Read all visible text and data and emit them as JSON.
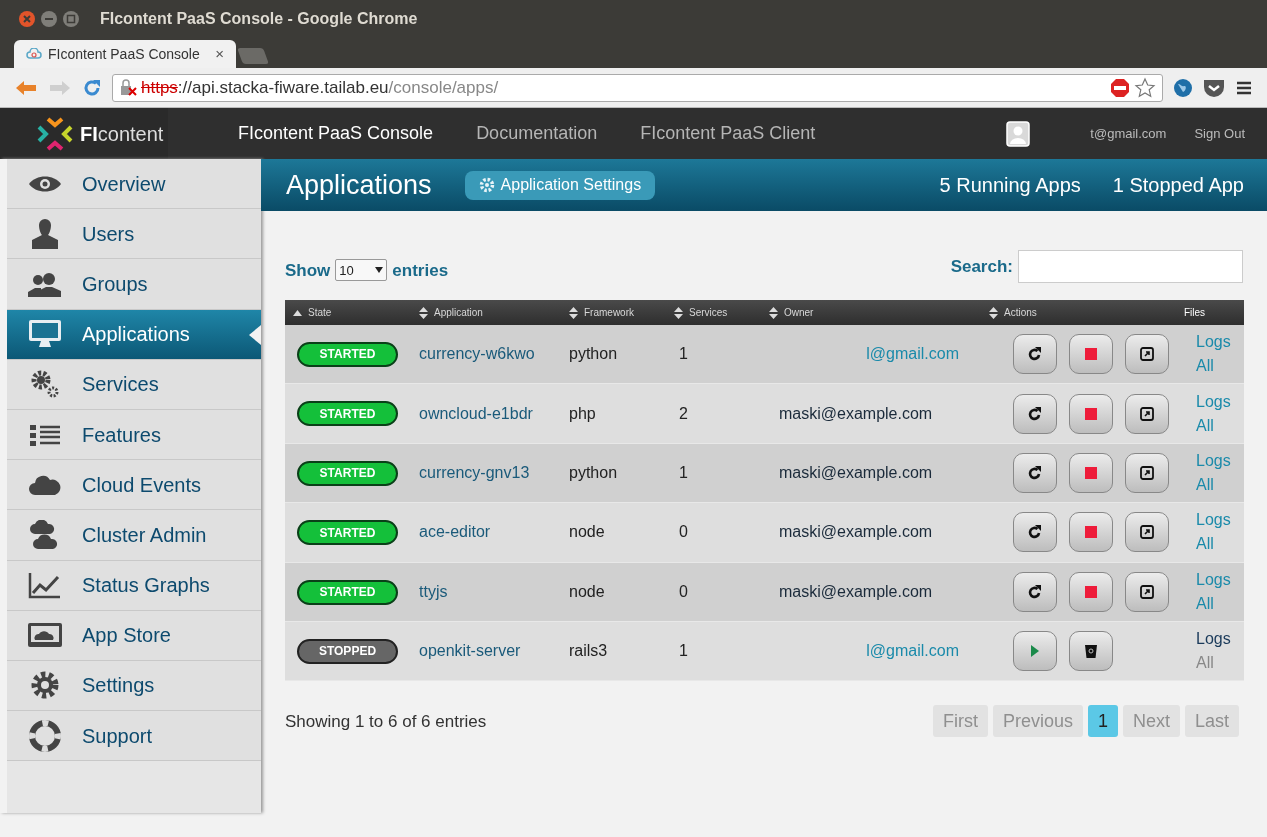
{
  "window": {
    "title": "FIcontent PaaS Console - Google Chrome"
  },
  "browser_tab": {
    "label": "FIcontent PaaS Console",
    "close": "×"
  },
  "address_bar": {
    "scheme": "https",
    "host": "://api.stacka-fiware.tailab.eu",
    "path": "/console/apps/"
  },
  "navbar": {
    "logo_bold": "FI",
    "logo_light": "content",
    "links": [
      {
        "label": "FIcontent PaaS Console",
        "selected": true
      },
      {
        "label": "Documentation",
        "selected": false
      },
      {
        "label": "FIcontent PaaS Client",
        "selected": false
      }
    ],
    "user_email": "t@gmail.com",
    "sign_out": "Sign Out"
  },
  "sidebar": {
    "items": [
      {
        "label": "Overview",
        "selected": false
      },
      {
        "label": "Users",
        "selected": false
      },
      {
        "label": "Groups",
        "selected": false
      },
      {
        "label": "Applications",
        "selected": true
      },
      {
        "label": "Services",
        "selected": false
      },
      {
        "label": "Features",
        "selected": false
      },
      {
        "label": "Cloud Events",
        "selected": false
      },
      {
        "label": "Cluster Admin",
        "selected": false
      },
      {
        "label": "Status Graphs",
        "selected": false
      },
      {
        "label": "App Store",
        "selected": false
      },
      {
        "label": "Settings",
        "selected": false
      },
      {
        "label": "Support",
        "selected": false
      }
    ]
  },
  "header": {
    "title": "Applications",
    "settings_button": "Application Settings",
    "running": "5 Running Apps",
    "stopped": "1 Stopped App"
  },
  "table_controls": {
    "show": "Show",
    "page_size": "10",
    "entries": "entries",
    "search_label": "Search:"
  },
  "table": {
    "columns": [
      {
        "label": "State",
        "sortable": true,
        "sorted": true
      },
      {
        "label": "Application",
        "sortable": true,
        "sorted": false
      },
      {
        "label": "Framework",
        "sortable": true,
        "sorted": false
      },
      {
        "label": "Services",
        "sortable": true,
        "sorted": false
      },
      {
        "label": "Owner",
        "sortable": true,
        "sorted": false
      },
      {
        "label": "Actions",
        "sortable": true,
        "sorted": false
      },
      {
        "label": "Files",
        "sortable": false,
        "sorted": false
      }
    ],
    "rows": [
      {
        "state": "STARTED",
        "kind": "started",
        "application": "currency-w6kwo",
        "framework": "python",
        "services": "1",
        "owner": "l@gmail.com",
        "owner_link": true,
        "actions": [
          {
            "kind": "restart"
          },
          {
            "kind": "stop"
          },
          {
            "kind": "open"
          }
        ],
        "files": [
          {
            "label": "Logs",
            "disabled": false
          },
          {
            "label": "All",
            "disabled": false
          }
        ]
      },
      {
        "state": "STARTED",
        "kind": "started",
        "application": "owncloud-e1bdr",
        "framework": "php",
        "services": "2",
        "owner": "maski@example.com",
        "owner_link": false,
        "actions": [
          {
            "kind": "restart"
          },
          {
            "kind": "stop"
          },
          {
            "kind": "open"
          }
        ],
        "files": [
          {
            "label": "Logs",
            "disabled": false
          },
          {
            "label": "All",
            "disabled": false
          }
        ]
      },
      {
        "state": "STARTED",
        "kind": "started",
        "application": "currency-gnv13",
        "framework": "python",
        "services": "1",
        "owner": "maski@example.com",
        "owner_link": false,
        "actions": [
          {
            "kind": "restart"
          },
          {
            "kind": "stop"
          },
          {
            "kind": "open"
          }
        ],
        "files": [
          {
            "label": "Logs",
            "disabled": false
          },
          {
            "label": "All",
            "disabled": false
          }
        ]
      },
      {
        "state": "STARTED",
        "kind": "started",
        "application": "ace-editor",
        "framework": "node",
        "services": "0",
        "owner": "maski@example.com",
        "owner_link": false,
        "actions": [
          {
            "kind": "restart"
          },
          {
            "kind": "stop"
          },
          {
            "kind": "open"
          }
        ],
        "files": [
          {
            "label": "Logs",
            "disabled": false
          },
          {
            "label": "All",
            "disabled": false
          }
        ]
      },
      {
        "state": "STARTED",
        "kind": "started",
        "application": "ttyjs",
        "framework": "node",
        "services": "0",
        "owner": "maski@example.com",
        "owner_link": false,
        "actions": [
          {
            "kind": "restart"
          },
          {
            "kind": "stop"
          },
          {
            "kind": "open"
          }
        ],
        "files": [
          {
            "label": "Logs",
            "disabled": false
          },
          {
            "label": "All",
            "disabled": false
          }
        ]
      },
      {
        "state": "STOPPED",
        "kind": "stopped",
        "application": "openkit-server",
        "framework": "rails3",
        "services": "1",
        "owner": "l@gmail.com",
        "owner_link": true,
        "actions": [
          {
            "kind": "start"
          },
          {
            "kind": "delete"
          }
        ],
        "files": [
          {
            "label": "Logs",
            "disabled": false
          },
          {
            "label": "All",
            "disabled": true
          }
        ]
      }
    ]
  },
  "footer": {
    "info": "Showing 1 to 6 of 6 entries",
    "pagination": [
      {
        "label": "First",
        "selected": false,
        "disabled": true
      },
      {
        "label": "Previous",
        "selected": false,
        "disabled": true
      },
      {
        "label": "1",
        "selected": true,
        "disabled": false
      },
      {
        "label": "Next",
        "selected": false,
        "disabled": true
      },
      {
        "label": "Last",
        "selected": false,
        "disabled": true
      }
    ]
  }
}
